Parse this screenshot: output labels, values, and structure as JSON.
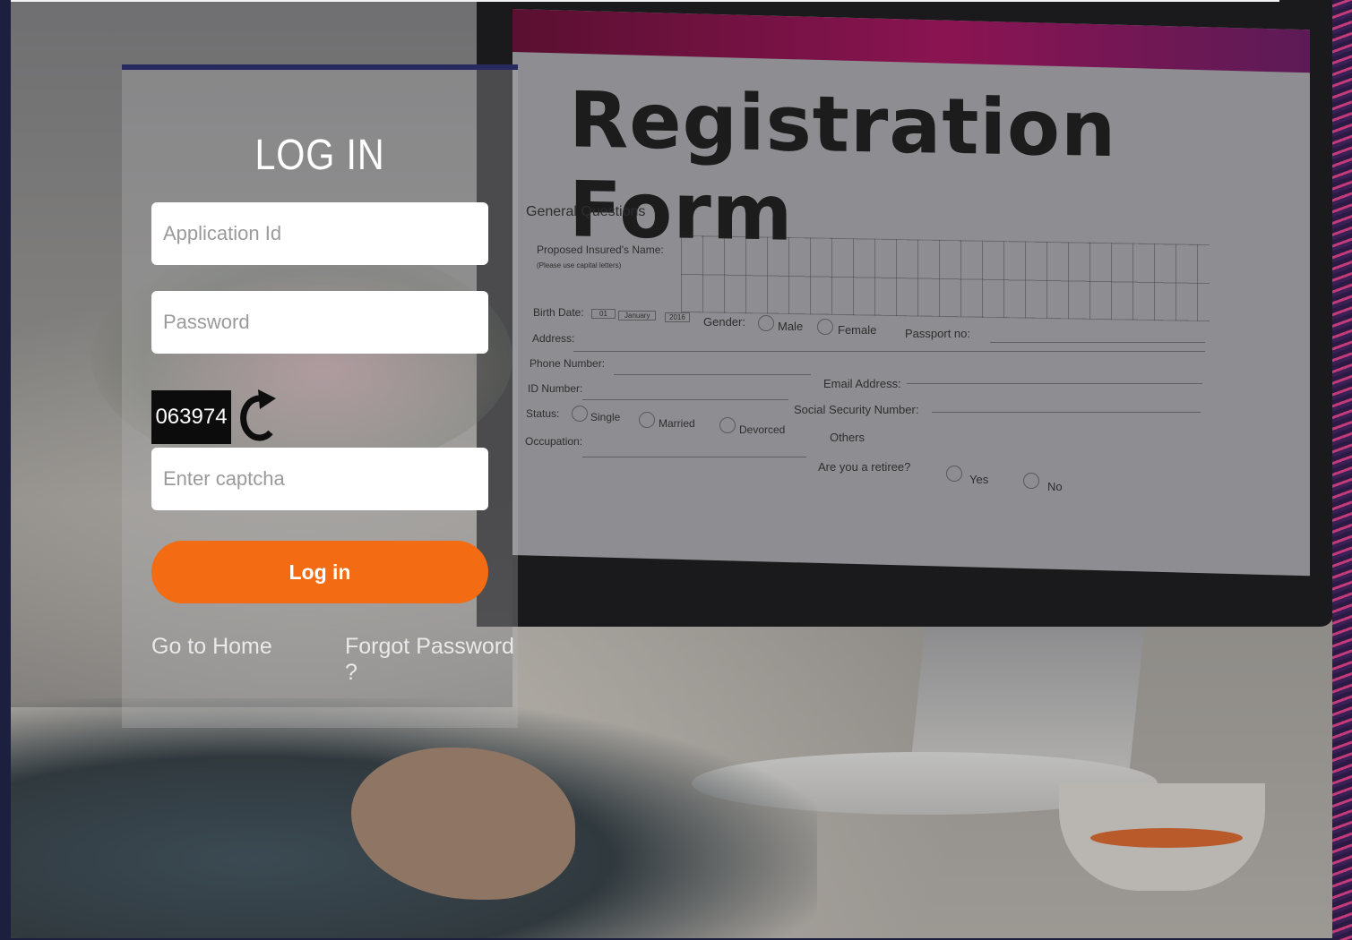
{
  "login": {
    "title": "LOG IN",
    "application_id_placeholder": "Application Id",
    "password_placeholder": "Password",
    "captcha_code": "063974",
    "captcha_placeholder": "Enter captcha",
    "login_button": "Log in",
    "home_link": "Go to Home",
    "forgot_link": "Forgot Password ?"
  },
  "background_form": {
    "title": "Registration Form",
    "section": "General Questions",
    "fields": {
      "name": "Proposed Insured's Name:",
      "name_hint": "(Please use capital letters)",
      "birth_date": "Birth Date:",
      "dd": "01",
      "month": "January",
      "year": "2016",
      "gender": "Gender:",
      "male": "Male",
      "female": "Female",
      "passport": "Passport no:",
      "address": "Address:",
      "phone": "Phone Number:",
      "email": "Email Address:",
      "id_number": "ID Number:",
      "ssn": "Social Security Number:",
      "status": "Status:",
      "single": "Single",
      "married": "Married",
      "devorced": "Devorced",
      "others": "Others",
      "occupation": "Occupation:",
      "retiree": "Are you a retiree?",
      "yes": "Yes",
      "no": "No"
    }
  },
  "colors": {
    "accent_orange": "#f36b12",
    "card_top_border": "#262a5e",
    "page_frame": "#1c1f3e"
  }
}
